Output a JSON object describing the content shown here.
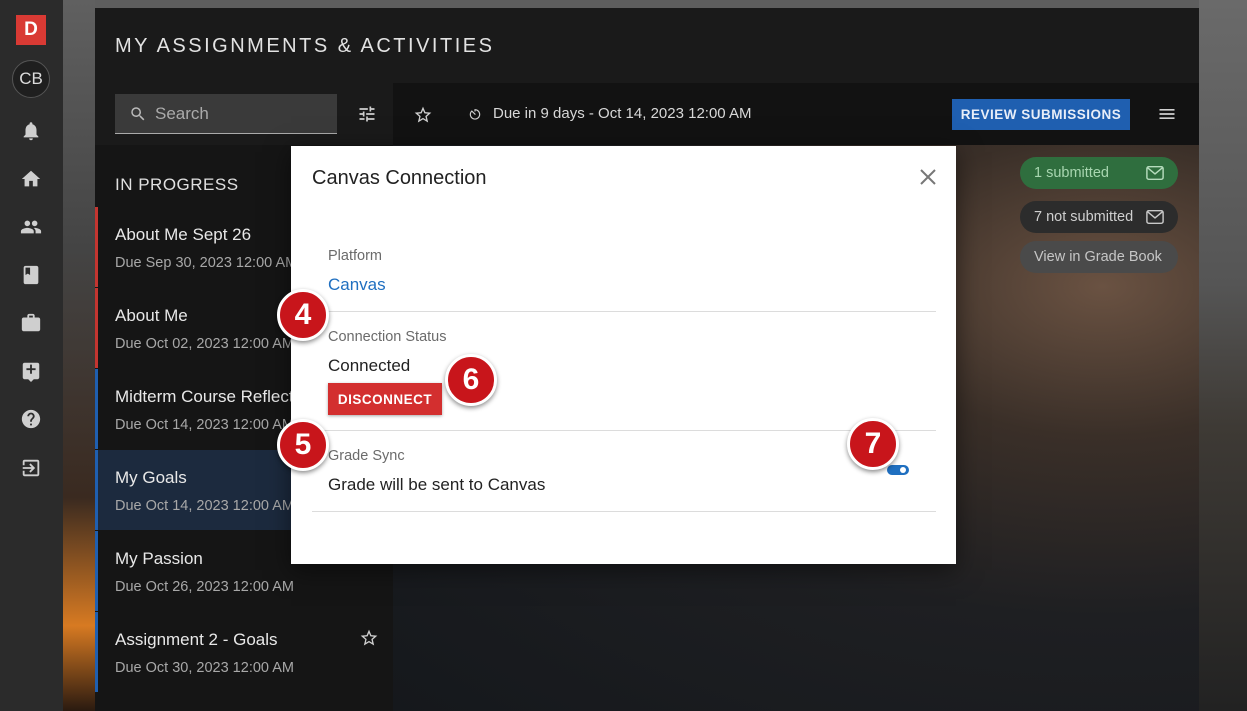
{
  "rail": {
    "logo": "D",
    "avatar": "CB",
    "icons": [
      "bell-icon",
      "home-icon",
      "people-icon",
      "book-icon",
      "briefcase-icon",
      "add-task-icon",
      "help-icon",
      "logout-icon"
    ]
  },
  "header": {
    "title": "MY ASSIGNMENTS & ACTIVITIES"
  },
  "search": {
    "placeholder": "Search"
  },
  "list": {
    "heading": "IN PROGRESS",
    "items": [
      {
        "name": "About Me Sept 26",
        "due": "Due Sep 30, 2023 12:00 AM",
        "accent": "red"
      },
      {
        "name": "About Me",
        "due": "Due Oct 02, 2023 12:00 AM",
        "accent": "red"
      },
      {
        "name": "Midterm Course Reflect",
        "due": "Due Oct 14, 2023 12:00 AM",
        "accent": "blue"
      },
      {
        "name": "My Goals",
        "due": "Due Oct 14, 2023 12:00 AM",
        "accent": "blue",
        "selected": true
      },
      {
        "name": "My Passion",
        "due": "Due Oct 26, 2023 12:00 AM",
        "accent": "blue"
      },
      {
        "name": "Assignment 2 - Goals",
        "due": "Due Oct 30, 2023 12:00 AM",
        "accent": "blue"
      }
    ]
  },
  "toolbar": {
    "due_text": "Due in 9 days - Oct 14, 2023 12:00 AM",
    "review_label": "REVIEW SUBMISSIONS"
  },
  "status_pills": {
    "submitted": "1 submitted",
    "not_submitted": "7 not submitted",
    "grade_book": "View in Grade Book"
  },
  "modal": {
    "title": "Canvas Connection",
    "platform_label": "Platform",
    "platform_value": "Canvas",
    "connection_label": "Connection Status",
    "connection_value": "Connected",
    "disconnect_label": "DISCONNECT",
    "grade_sync_label": "Grade Sync",
    "grade_sync_value": "Grade will be sent to Canvas",
    "grade_sync_enabled": true
  },
  "callouts": [
    "4",
    "5",
    "6",
    "7"
  ],
  "colors": {
    "accent_blue": "#1f5fb0",
    "danger_red": "#d32f2f",
    "submitted_green": "#2f6e3e",
    "callout_red": "#c8151b"
  }
}
